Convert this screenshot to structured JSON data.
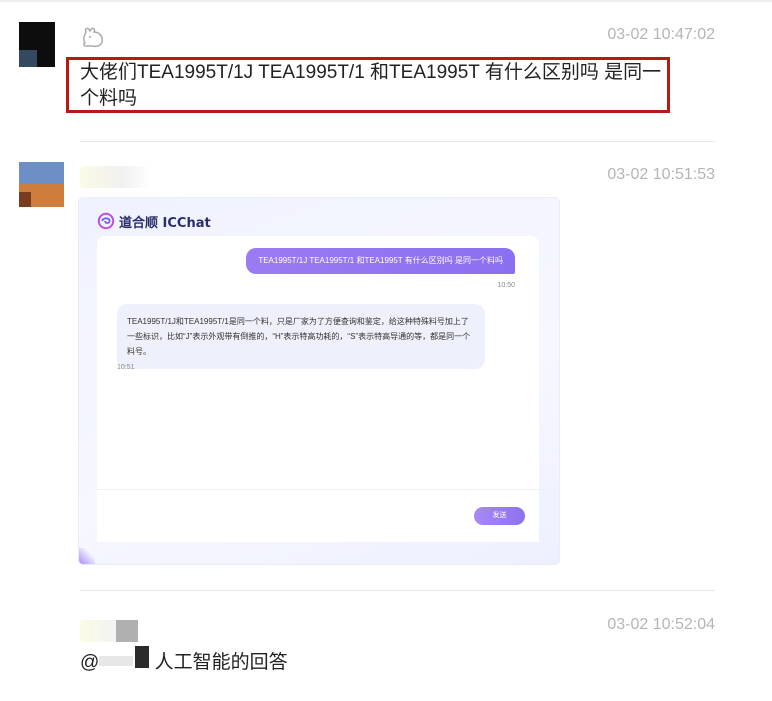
{
  "messages": [
    {
      "id": "m1",
      "timestamp": "03-02 10:47:02",
      "text": "大佬们TEA1995T/1J  TEA1995T/1    和TEA1995T  有什么区别吗 是同一个料吗"
    },
    {
      "id": "m2",
      "timestamp": "03-02 10:51:53",
      "screenshot": {
        "brand": "道合顺 ICChat",
        "user_message": "TEA1995T/1J TEA1995T/1 和TEA1995T 有什么区别吗 是同一个料吗",
        "user_time": "10:50",
        "bot_message": "TEA1995T/1J和TEA1995T/1是同一个料，只是厂家为了方便查询和鉴定，给这种特殊料号加上了一些标识，比如“J”表示外观带有倒推的，“H”表示特高功耗的，“S”表示特高导通的等，都是同一个料号。",
        "bot_time": "10:51",
        "send_label": "发送"
      }
    },
    {
      "id": "m3",
      "timestamp": "03-02 10:52:04",
      "mention_prefix": "@",
      "text": "人工智能的回答"
    }
  ],
  "colors": {
    "highlight_border": "#b31b14",
    "accent_purple": "#9b7bf2",
    "timestamp": "#b5b5b5"
  },
  "icons": {
    "sender_icon": "rabbit-icon",
    "brand_logo": "swirl-logo-icon"
  }
}
